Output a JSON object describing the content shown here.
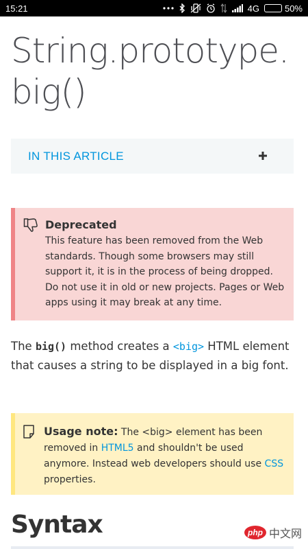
{
  "status_bar": {
    "time": "15:21",
    "network": "4G",
    "battery_percent_label": "50%",
    "battery_level": 0.5,
    "icons": [
      "ellipsis-icon",
      "bluetooth-icon",
      "vibrate-icon",
      "alarm-icon",
      "data-transfer-icon",
      "signal-icon",
      "battery-icon"
    ]
  },
  "page": {
    "title_line1": "String.prototype.",
    "title_line2": "big()"
  },
  "toc": {
    "label": "IN THIS ARTICLE",
    "expand_icon": "plus-icon"
  },
  "deprecated": {
    "heading": "Deprecated",
    "text": "This feature has been removed from the Web standards. Though some browsers may still support it, it is in the process of being dropped. Do not use it in old or new projects. Pages or Web apps using it may break at any time.",
    "icon": "thumbs-down-icon",
    "accent": "#ef8486",
    "background": "#f9d6d5"
  },
  "intro": {
    "prefix": "The ",
    "code": "big()",
    "middle": " method creates a ",
    "code_link": "<big>",
    "suffix": " HTML element that causes a string to be displayed in a big font."
  },
  "usage_note": {
    "heading": "Usage note:",
    "text_before": " The <big> element has been removed in ",
    "link1": "HTML5",
    "text_middle": " and shouldn't be used anymore. Instead web developers should use ",
    "link2": "CSS",
    "text_after": " properties.",
    "icon": "note-icon",
    "accent": "#ffe77f",
    "background": "#fff2c4"
  },
  "syntax": {
    "heading": "Syntax"
  },
  "watermark": {
    "badge": "php",
    "text": "中文网"
  },
  "colors": {
    "link": "#0095dd",
    "text": "#333333",
    "title": "#4d4e53"
  }
}
